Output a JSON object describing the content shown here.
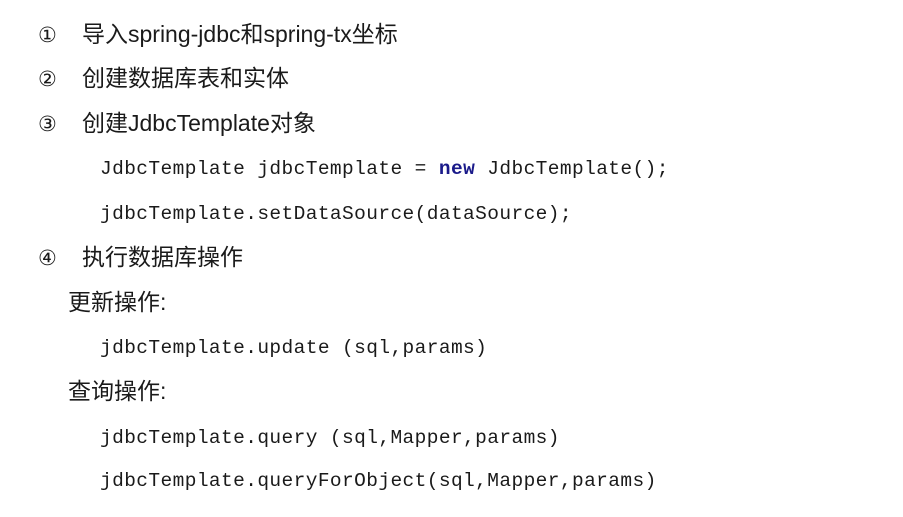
{
  "steps": [
    {
      "num": "①",
      "text": "导入spring-jdbc和spring-tx坐标"
    },
    {
      "num": "②",
      "text": "创建数据库表和实体"
    },
    {
      "num": "③",
      "text": "创建JdbcTemplate对象"
    },
    {
      "num": "④",
      "text": "执行数据库操作"
    }
  ],
  "create_code": {
    "line1_pre": "JdbcTemplate jdbcTemplate = ",
    "line1_kw": "new",
    "line1_post": " JdbcTemplate();",
    "line2": "jdbcTemplate.setDataSource(dataSource);"
  },
  "update": {
    "label": "更新操作:",
    "code": "jdbcTemplate.update (sql,params)"
  },
  "query": {
    "label": "查询操作:",
    "code1": "jdbcTemplate.query (sql,Mapper,params)",
    "code2": "jdbcTemplate.queryForObject(sql,Mapper,params)"
  },
  "colors": {
    "keyword": "#1a1a8a",
    "text": "#1a1a1a",
    "background": "#ffffff"
  }
}
